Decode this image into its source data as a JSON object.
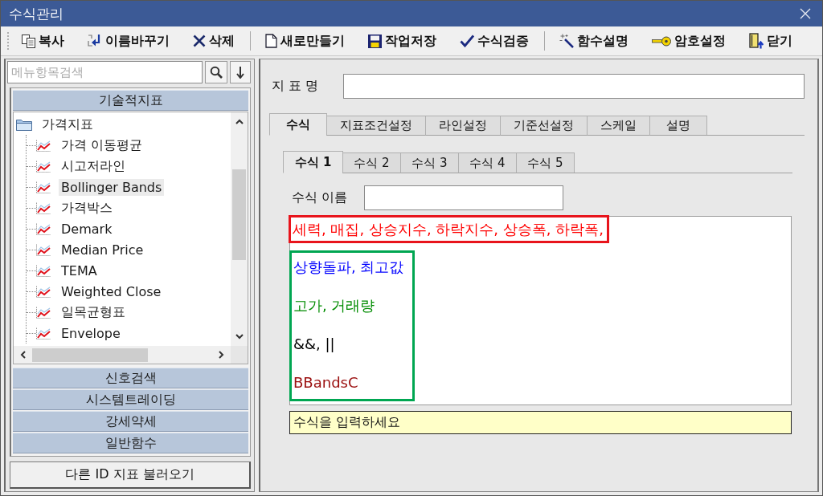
{
  "window": {
    "title": "수식관리"
  },
  "toolbar": {
    "groups": [
      {
        "items": [
          {
            "label": "복사"
          },
          {
            "label": "이름바꾸기"
          },
          {
            "label": "삭제"
          }
        ]
      },
      {
        "items": [
          {
            "label": "새로만들기"
          },
          {
            "label": "작업저장"
          },
          {
            "label": "수식검증"
          }
        ]
      },
      {
        "items": [
          {
            "label": "함수설명"
          },
          {
            "label": "암호설정"
          },
          {
            "label": "닫기"
          }
        ]
      }
    ]
  },
  "sidebar": {
    "search": {
      "placeholder": "메뉴항목검색"
    },
    "sections": [
      {
        "label": "기술적지표",
        "tree": [
          {
            "label": "가격지표",
            "selected": false,
            "expanded": true,
            "children": [
              {
                "label": "가격 이동평균",
                "selected": false
              },
              {
                "label": "시고저라인",
                "selected": false
              },
              {
                "label": "Bollinger Bands",
                "selected": true
              },
              {
                "label": "가격박스",
                "selected": false
              },
              {
                "label": "Demark",
                "selected": false
              },
              {
                "label": "Median Price",
                "selected": false
              },
              {
                "label": "TEMA",
                "selected": false
              },
              {
                "label": "Weighted Close",
                "selected": false
              },
              {
                "label": "일목균형표",
                "selected": false
              },
              {
                "label": "Envelope",
                "selected": false
              }
            ]
          }
        ]
      },
      {
        "label": "신호검색"
      },
      {
        "label": "시스템트레이딩"
      },
      {
        "label": "강세약세"
      },
      {
        "label": "일반함수"
      }
    ],
    "load_button": "다른 ID 지표 불러오기"
  },
  "editor_panel": {
    "indicator_name": {
      "label": "지 표 명"
    },
    "tabs": [
      {
        "label": "수식",
        "selected": true
      },
      {
        "label": "지표조건설정",
        "selected": false
      },
      {
        "label": "라인설정",
        "selected": false
      },
      {
        "label": "기준선설정",
        "selected": false
      },
      {
        "label": "스케일",
        "selected": false
      },
      {
        "label": "설명",
        "selected": false
      }
    ],
    "formula_tabs": [
      {
        "label": "수식 1",
        "selected": true
      },
      {
        "label": "수식 2",
        "selected": false
      },
      {
        "label": "수식 3",
        "selected": false
      },
      {
        "label": "수식 4",
        "selected": false
      },
      {
        "label": "수식 5",
        "selected": false
      }
    ],
    "formula_name": {
      "label": "수식 이름"
    },
    "formula_editor": {
      "frames": [
        {
          "color": "#e8141c",
          "lines": [
            {
              "text": "세력, 매집, 상승지수, 하락지수, 상승폭, 하락폭,",
              "color": "#ff0000"
            }
          ]
        },
        {
          "color": "#00a651",
          "lines": [
            {
              "text": "상향돌파, 최고값",
              "color": "#0000ff"
            },
            {
              "text": "고가, 거래량",
              "color": "#008c00"
            },
            {
              "text": "&&, ||",
              "color": "#000000"
            },
            {
              "text": "BBandsC",
              "color": "#9b1010"
            }
          ]
        }
      ]
    },
    "hint": "수식을 입력하세요"
  }
}
